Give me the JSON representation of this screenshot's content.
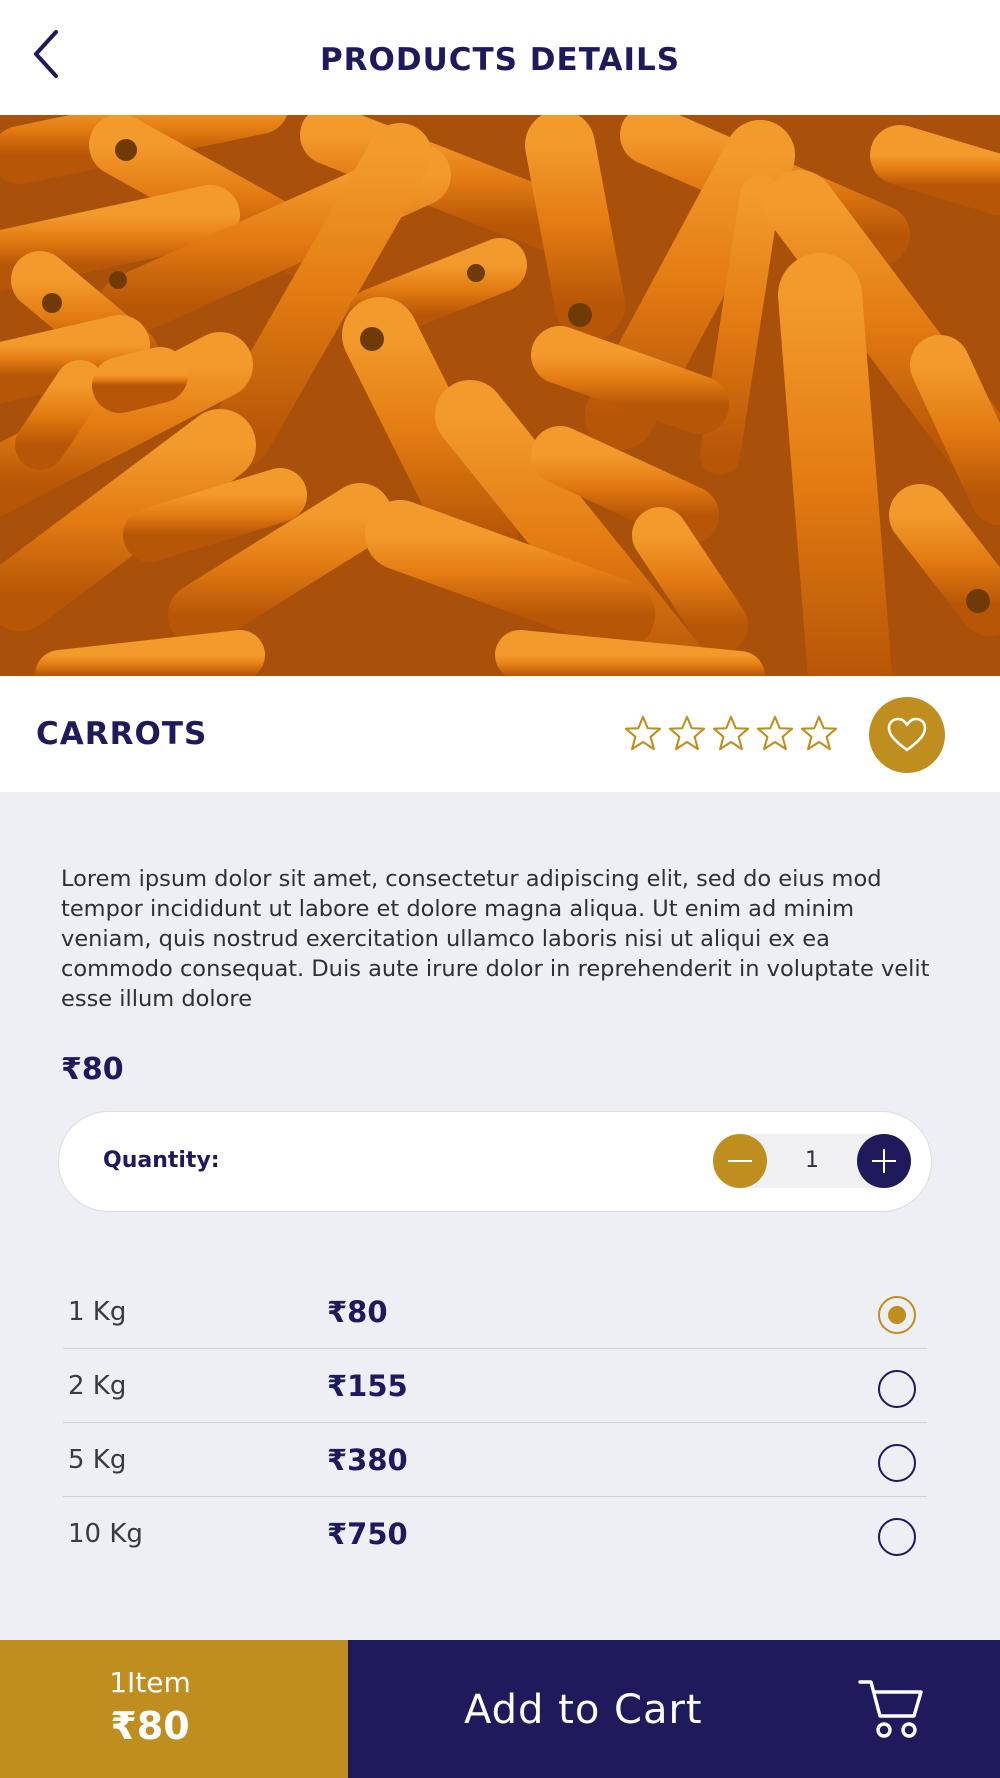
{
  "header": {
    "title": "PRODUCTS DETAILS"
  },
  "product": {
    "name": "CARROTS",
    "rating": 0,
    "rating_max": 5,
    "description": "Lorem ipsum dolor sit amet, consectetur adipiscing elit, sed do eius mod tempor incididunt ut labore et dolore magna aliqua. Ut enim ad minim veniam, quis nostrud exercitation ullamco laboris nisi ut aliqui ex ea commodo consequat. Duis aute irure dolor in reprehenderit in voluptate velit esse illum dolore",
    "price": "₹80"
  },
  "quantity": {
    "label": "Quantity:",
    "value": "1"
  },
  "options": [
    {
      "weight": "1 Kg",
      "price": "₹80",
      "selected": true
    },
    {
      "weight": "2 Kg",
      "price": "₹155",
      "selected": false
    },
    {
      "weight": "5 Kg",
      "price": "₹380",
      "selected": false
    },
    {
      "weight": "10 Kg",
      "price": "₹750",
      "selected": false
    }
  ],
  "footer": {
    "count": "1Item",
    "total": "₹80",
    "cart_label": "Add to Cart"
  },
  "icons": [
    "back-arrow-icon",
    "star-outline-icon",
    "heart-icon",
    "minus-icon",
    "plus-icon",
    "radio-icon",
    "cart-icon"
  ],
  "colors": {
    "navy": "#1e1a5c",
    "gold": "#bf8e1f",
    "background": "#eeeff4",
    "carrot": "#e07a10"
  }
}
